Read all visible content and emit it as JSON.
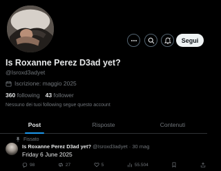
{
  "profile": {
    "name": "Is Roxanne Perez D3ad yet?",
    "handle": "@Isroxd3adyet",
    "joined": "Iscrizione: maggio 2025",
    "following_count": "360",
    "following_label": "following",
    "followers_count": "43",
    "followers_label": "follower",
    "no_follow_note": "Nessuno dei tuoi following segue questo account"
  },
  "header": {
    "follow_label": "Segui",
    "icons": [
      "more-icon",
      "search-icon",
      "bell-icon"
    ]
  },
  "tabs": [
    {
      "label": "Post",
      "active": true
    },
    {
      "label": "Risposte",
      "active": false
    },
    {
      "label": "Contenuti",
      "active": false
    }
  ],
  "pinned_post": {
    "pinned_label": "Fissato",
    "author_name": "Is Roxanne Perez D3ad yet?",
    "author_handle": "@Isroxd3adyet",
    "date": "· 30 mag",
    "text": "Friday 6 June 2025",
    "replies": "98",
    "reposts": "27",
    "likes": "5",
    "views": "55.504"
  },
  "colors": {
    "accent": "#1d9bf0",
    "background": "#000000",
    "muted": "#71767b"
  }
}
